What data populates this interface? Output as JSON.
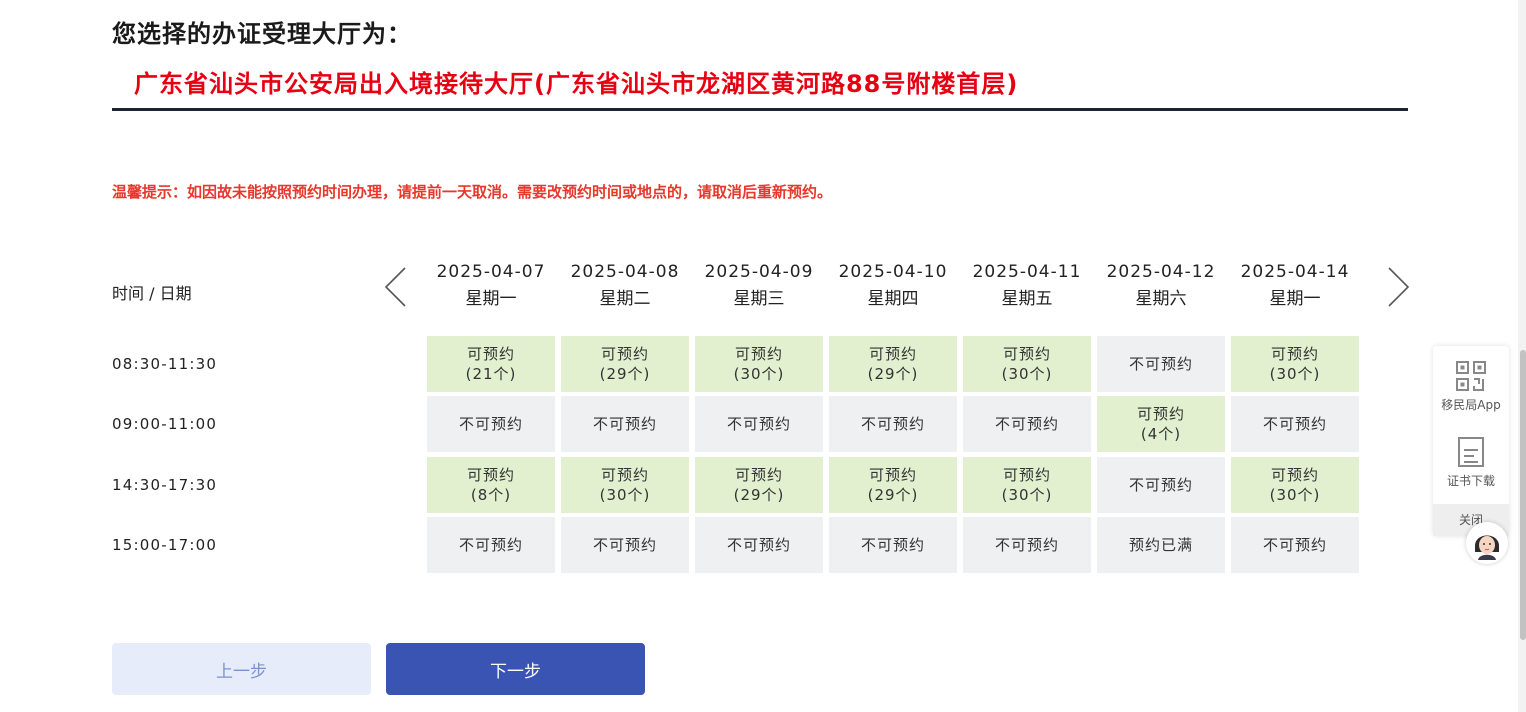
{
  "heading": "您选择的办证受理大厅为：",
  "hall": "广东省汕头市公安局出入境接待大厅(广东省汕头市龙湖区黄河路88号附楼首层)",
  "tip": "温馨提示：如因故未能按照预约时间办理，请提前一天取消。需要改预约时间或地点的，请取消后重新预约。",
  "schedule": {
    "corner_label": "时间 / 日期",
    "days": [
      {
        "date": "2025-04-07",
        "weekday": "星期一"
      },
      {
        "date": "2025-04-08",
        "weekday": "星期二"
      },
      {
        "date": "2025-04-09",
        "weekday": "星期三"
      },
      {
        "date": "2025-04-10",
        "weekday": "星期四"
      },
      {
        "date": "2025-04-11",
        "weekday": "星期五"
      },
      {
        "date": "2025-04-12",
        "weekday": "星期六"
      },
      {
        "date": "2025-04-14",
        "weekday": "星期一"
      }
    ],
    "rows": [
      {
        "time": "08:30-11:30",
        "cells": [
          {
            "status": "可预约",
            "count": "(21个)"
          },
          {
            "status": "可预约",
            "count": "(29个)"
          },
          {
            "status": "可预约",
            "count": "(30个)"
          },
          {
            "status": "可预约",
            "count": "(29个)"
          },
          {
            "status": "可预约",
            "count": "(30个)"
          },
          {
            "status": "不可预约",
            "count": ""
          },
          {
            "status": "可预约",
            "count": "(30个)"
          }
        ]
      },
      {
        "time": "09:00-11:00",
        "cells": [
          {
            "status": "不可预约",
            "count": ""
          },
          {
            "status": "不可预约",
            "count": ""
          },
          {
            "status": "不可预约",
            "count": ""
          },
          {
            "status": "不可预约",
            "count": ""
          },
          {
            "status": "不可预约",
            "count": ""
          },
          {
            "status": "可预约",
            "count": "(4个)"
          },
          {
            "status": "不可预约",
            "count": ""
          }
        ]
      },
      {
        "time": "14:30-17:30",
        "cells": [
          {
            "status": "可预约",
            "count": "(8个)"
          },
          {
            "status": "可预约",
            "count": "(30个)"
          },
          {
            "status": "可预约",
            "count": "(29个)"
          },
          {
            "status": "可预约",
            "count": "(29个)"
          },
          {
            "status": "可预约",
            "count": "(30个)"
          },
          {
            "status": "不可预约",
            "count": ""
          },
          {
            "status": "可预约",
            "count": "(30个)"
          }
        ]
      },
      {
        "time": "15:00-17:00",
        "cells": [
          {
            "status": "不可预约",
            "count": ""
          },
          {
            "status": "不可预约",
            "count": ""
          },
          {
            "status": "不可预约",
            "count": ""
          },
          {
            "status": "不可预约",
            "count": ""
          },
          {
            "status": "不可预约",
            "count": ""
          },
          {
            "status": "预约已满",
            "count": ""
          },
          {
            "status": "不可预约",
            "count": ""
          }
        ]
      }
    ]
  },
  "buttons": {
    "prev": "上一步",
    "next": "下一步"
  },
  "side_panel": {
    "app": "移民局App",
    "cert": "证书下载",
    "close": "关闭"
  },
  "colors": {
    "available": "#e2f0d0",
    "unavailable": "#eef0f2",
    "hall_red": "#e60012",
    "tip_red": "#e8372b",
    "primary": "#3a54b4"
  }
}
